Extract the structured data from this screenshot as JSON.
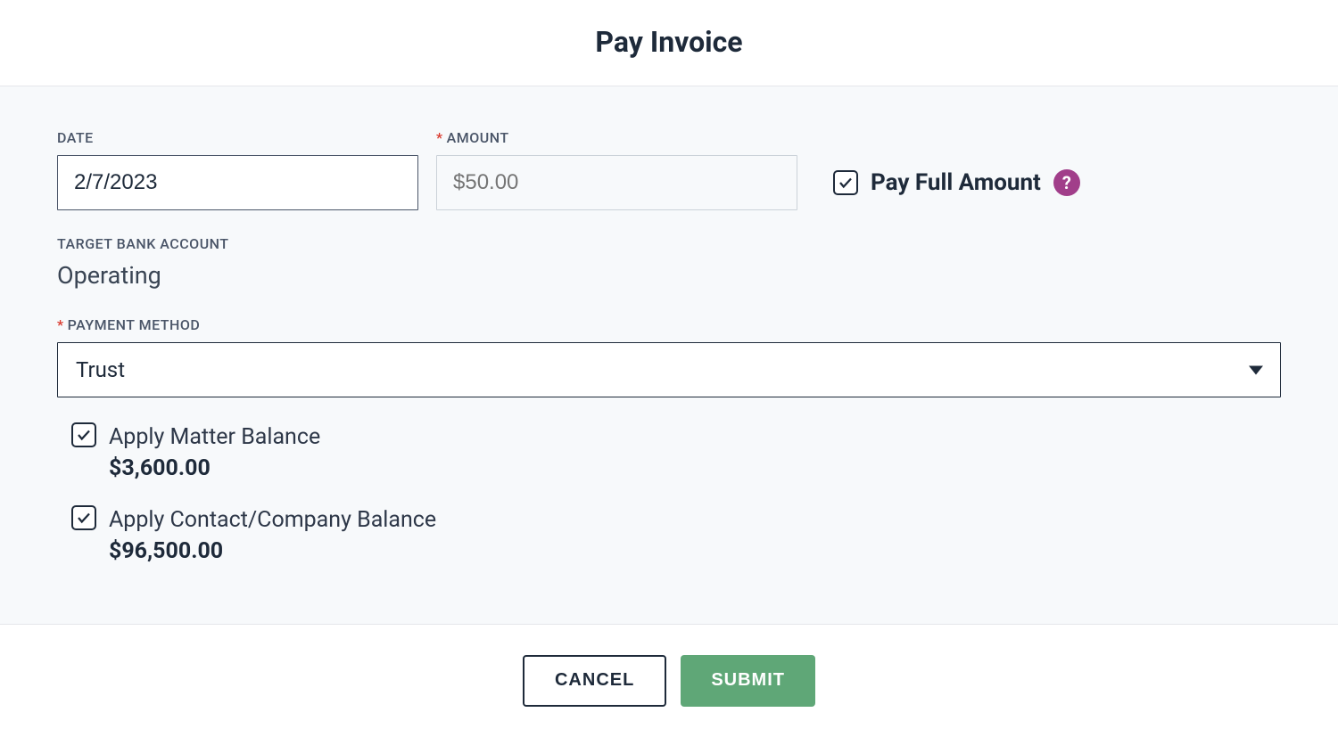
{
  "header": {
    "title": "Pay Invoice"
  },
  "form": {
    "date": {
      "label": "DATE",
      "value": "2/7/2023"
    },
    "amount": {
      "label": "AMOUNT",
      "required_marker": "*",
      "placeholder": "$50.00",
      "value": ""
    },
    "pay_full": {
      "label": "Pay Full Amount",
      "checked": true
    },
    "target_bank": {
      "label": "TARGET BANK ACCOUNT",
      "value": "Operating"
    },
    "payment_method": {
      "label": "PAYMENT METHOD",
      "required_marker": "*",
      "selected": "Trust"
    },
    "balances": [
      {
        "label": "Apply Matter Balance",
        "amount": "$3,600.00",
        "checked": true
      },
      {
        "label": "Apply Contact/Company Balance",
        "amount": "$96,500.00",
        "checked": true
      }
    ]
  },
  "footer": {
    "cancel": "CANCEL",
    "submit": "SUBMIT"
  }
}
